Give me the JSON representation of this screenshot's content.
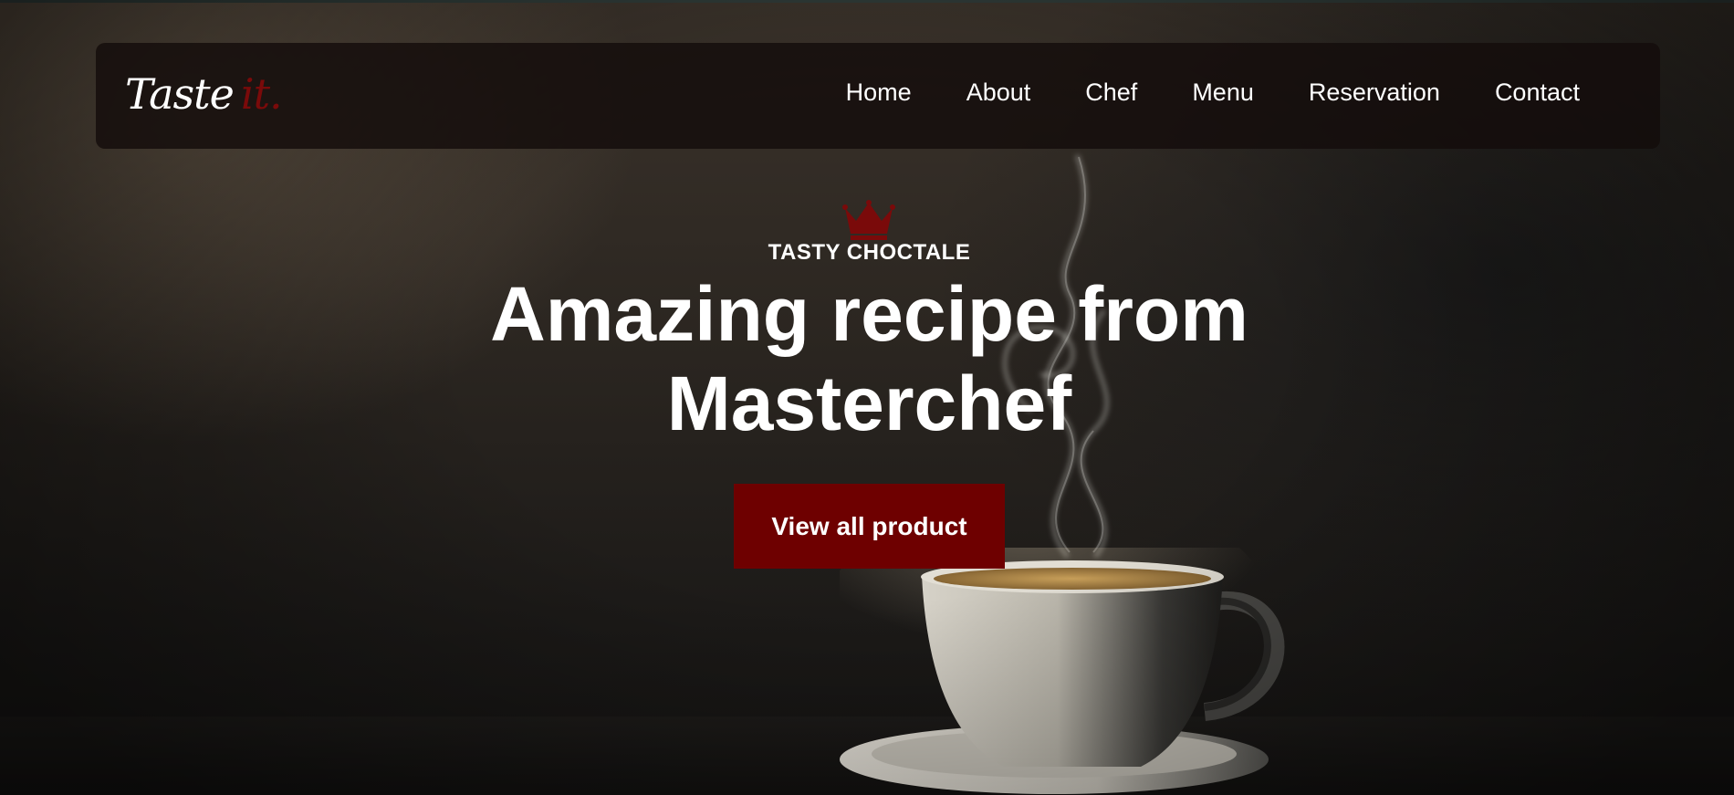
{
  "brand": {
    "logo_main": "Taste",
    "logo_accent": "it."
  },
  "nav": {
    "items": [
      "Home",
      "About",
      "Chef",
      "Menu",
      "Reservation",
      "Contact"
    ]
  },
  "hero": {
    "eyebrow": "TASTY CHOCTALE",
    "headline_line1": "Amazing recipe from",
    "headline_line2": "Masterchef",
    "cta_label": "View all product"
  },
  "icons": {
    "crown": "crown-icon"
  },
  "colors": {
    "accent": "#6e0000",
    "navbar_bg": "#140c0b",
    "text": "#ffffff"
  }
}
